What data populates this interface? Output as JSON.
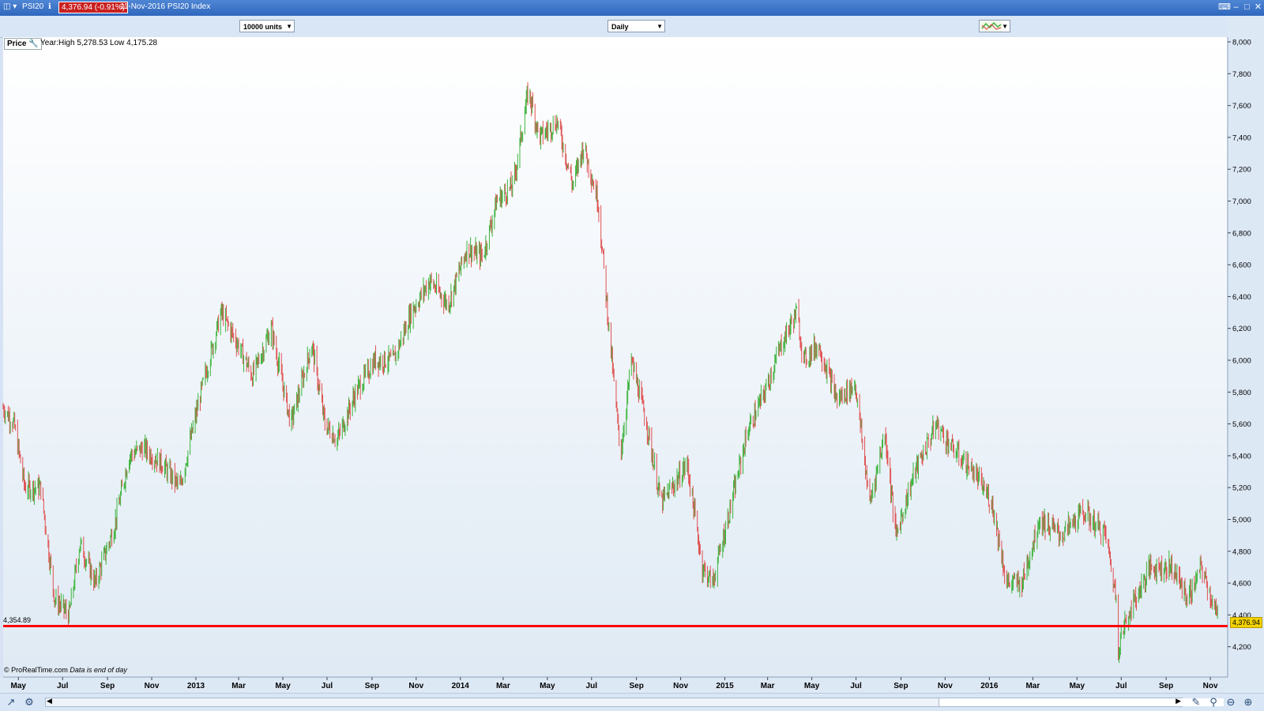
{
  "titlebar": {
    "symbol": "PSI20",
    "price_badge": "4,376.94 (-0.91%)",
    "description": "11-Nov-2016 PSI20 Index"
  },
  "toolbar": {
    "units_select": "10000 units",
    "period_select": "Daily"
  },
  "chart_header": {
    "price_label": "Price",
    "year_high_low": "Year:High 5,278.53 Low 4,175.28"
  },
  "footer_note": {
    "source": "© ProRealTime.com",
    "note": "Data is end of day"
  },
  "level_line_label": "4,354.89",
  "last_price_badge": "4,376.94",
  "colors": {
    "up_bar": "#3cb43c",
    "down_bar": "#e05050",
    "level_line": "#ff0000",
    "last_badge": "#f2d200"
  },
  "chart_data": {
    "type": "line",
    "chart_style": "ohlc-bars",
    "x_ticks": [
      "May",
      "Jul",
      "Sep",
      "Nov",
      "2013",
      "Mar",
      "May",
      "Jul",
      "Sep",
      "Nov",
      "2014",
      "Mar",
      "May",
      "Jul",
      "Sep",
      "Nov",
      "2015",
      "Mar",
      "May",
      "Jul",
      "Sep",
      "Nov",
      "2016",
      "Mar",
      "May",
      "Jul",
      "Sep",
      "Nov"
    ],
    "y_ticks": [
      "8,000",
      "7,800",
      "7,600",
      "7,400",
      "7,200",
      "7,000",
      "6,800",
      "6,600",
      "6,400",
      "6,200",
      "6,000",
      "5,800",
      "5,600",
      "5,400",
      "5,200",
      "5,000",
      "4,800",
      "4,600",
      "4,400",
      "4,200"
    ],
    "ylim": [
      4100,
      8000
    ],
    "xlim": [
      "2012-04-10",
      "2016-11-14"
    ],
    "horizontal_line": 4354.89,
    "last_price": 4376.94,
    "series": [
      {
        "x": [
          "2012-04-10",
          "2012-04-25",
          "2012-05-10",
          "2012-06-01",
          "2012-06-20",
          "2012-07-10",
          "2012-07-25",
          "2012-08-15",
          "2012-09-10",
          "2012-10-01",
          "2012-10-20",
          "2012-11-15",
          "2012-12-10",
          "2013-01-08",
          "2013-02-05",
          "2013-02-28",
          "2013-03-20",
          "2013-04-15",
          "2013-05-12",
          "2013-06-10",
          "2013-06-28",
          "2013-07-15",
          "2013-08-10",
          "2013-09-05",
          "2013-10-01",
          "2013-10-25",
          "2013-11-20",
          "2013-12-15",
          "2014-01-10",
          "2014-02-01",
          "2014-02-20",
          "2014-03-15",
          "2014-04-05",
          "2014-04-20",
          "2014-05-15",
          "2014-06-05",
          "2014-06-20",
          "2014-07-10",
          "2014-07-25",
          "2014-08-10",
          "2014-08-25",
          "2014-09-15",
          "2014-10-05",
          "2014-10-20",
          "2014-11-10",
          "2014-12-01",
          "2014-12-15",
          "2015-01-10",
          "2015-02-01",
          "2015-02-25",
          "2015-03-20",
          "2015-04-10",
          "2015-04-20",
          "2015-05-10",
          "2015-06-05",
          "2015-06-30",
          "2015-07-20",
          "2015-08-10",
          "2015-08-25",
          "2015-09-20",
          "2015-10-20",
          "2015-11-10",
          "2015-12-10",
          "2016-01-05",
          "2016-01-25",
          "2016-02-15",
          "2016-03-10",
          "2016-04-10",
          "2016-05-10",
          "2016-06-10",
          "2016-06-24",
          "2016-06-27",
          "2016-07-10",
          "2016-08-10",
          "2016-09-10",
          "2016-10-01",
          "2016-10-20",
          "2016-11-11"
        ],
        "close": [
          5700,
          5600,
          5200,
          5200,
          4500,
          4400,
          4850,
          4600,
          4950,
          5400,
          5450,
          5350,
          5200,
          5800,
          6300,
          6100,
          5900,
          6200,
          5600,
          6100,
          5600,
          5500,
          5800,
          6000,
          6000,
          6300,
          6500,
          6350,
          6700,
          6650,
          7000,
          7100,
          7700,
          7400,
          7500,
          7100,
          7350,
          7000,
          6200,
          5400,
          6000,
          5600,
          5100,
          5200,
          5350,
          4700,
          4600,
          5100,
          5550,
          5800,
          6100,
          6300,
          6000,
          6100,
          5750,
          5850,
          5100,
          5550,
          4900,
          5300,
          5600,
          5450,
          5300,
          5100,
          4600,
          4600,
          5000,
          4900,
          5050,
          4900,
          4500,
          4200,
          4400,
          4700,
          4700,
          4500,
          4700,
          4380
        ]
      }
    ]
  }
}
